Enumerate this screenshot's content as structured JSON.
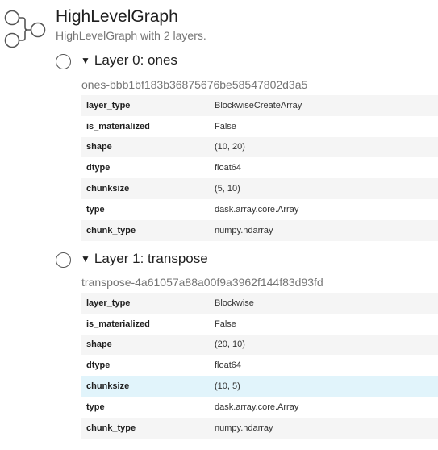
{
  "header": {
    "title": "HighLevelGraph",
    "subtitle": "HighLevelGraph with 2 layers."
  },
  "layers": [
    {
      "heading": "Layer 0: ones",
      "name": "ones-bbb1bf183b36875676be58547802d3a5",
      "attributes": [
        {
          "key": "layer_type",
          "value": "BlockwiseCreateArray"
        },
        {
          "key": "is_materialized",
          "value": "False"
        },
        {
          "key": "shape",
          "value": "(10, 20)"
        },
        {
          "key": "dtype",
          "value": "float64"
        },
        {
          "key": "chunksize",
          "value": "(5, 10)"
        },
        {
          "key": "type",
          "value": "dask.array.core.Array"
        },
        {
          "key": "chunk_type",
          "value": "numpy.ndarray"
        }
      ]
    },
    {
      "heading": "Layer 1: transpose",
      "name": "transpose-4a61057a88a00f9a3962f144f83d93fd",
      "attributes": [
        {
          "key": "layer_type",
          "value": "Blockwise"
        },
        {
          "key": "is_materialized",
          "value": "False"
        },
        {
          "key": "shape",
          "value": "(20, 10)"
        },
        {
          "key": "dtype",
          "value": "float64"
        },
        {
          "key": "chunksize",
          "value": "(10, 5)"
        },
        {
          "key": "type",
          "value": "dask.array.core.Array"
        },
        {
          "key": "chunk_type",
          "value": "numpy.ndarray"
        }
      ]
    }
  ],
  "icons": {
    "graph": "graph-nodes-icon",
    "layer": "layer-circle-icon",
    "toggle": "disclosure-triangle-icon"
  }
}
